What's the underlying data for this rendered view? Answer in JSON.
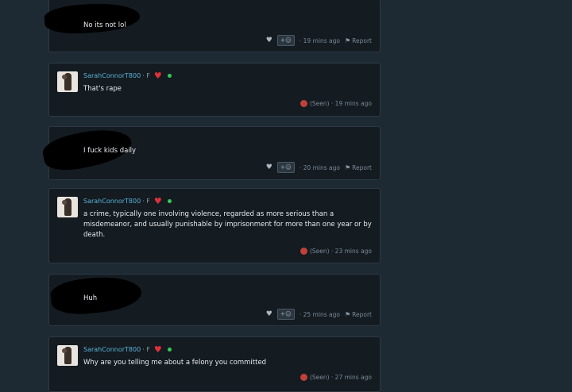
{
  "messages": [
    {
      "type": "other",
      "text": "No its not lol",
      "time": "· 19 mins ago",
      "react": "+☺",
      "report": "Report"
    },
    {
      "type": "self",
      "user": "SarahConnorT800",
      "gender": "· F",
      "text": "That's rape",
      "seen": "(Seen) · 19 mins ago"
    },
    {
      "type": "other",
      "text": "I fuck kids daily",
      "time": "· 20 mins ago",
      "react": "+☺",
      "report": "Report"
    },
    {
      "type": "self",
      "user": "SarahConnorT800",
      "gender": "· F",
      "text": "a crime, typically one involving violence, regarded as more serious than a misdemeanor, and usually punishable by imprisonment for more than one year or by death.",
      "seen": "(Seen) · 23 mins ago"
    },
    {
      "type": "other",
      "text": "Huh",
      "time": "· 25 mins ago",
      "react": "+☺",
      "report": "Report"
    },
    {
      "type": "self",
      "user": "SarahConnorT800",
      "gender": "· F",
      "text": "Why are you telling me about a felony you committed",
      "seen": "(Seen) · 27 mins ago"
    }
  ],
  "icons": {
    "like": "heart-icon",
    "flag": "flag-icon",
    "favorite": "red-heart-icon",
    "online": "online-dot"
  },
  "colors": {
    "username": "#5bb3d6",
    "heart": "#e0303a",
    "online": "#36c95a"
  }
}
